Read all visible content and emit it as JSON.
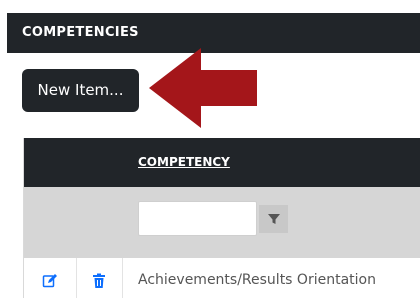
{
  "section": {
    "title": "COMPETENCIES"
  },
  "toolbar": {
    "new_item_label": "New Item..."
  },
  "table": {
    "columns": [
      {
        "label": "COMPETENCY"
      }
    ],
    "filter": {
      "value": "",
      "icon": "filter-icon"
    },
    "rows": [
      {
        "competency": "Achievements/Results Orientation"
      }
    ]
  },
  "colors": {
    "header_bg": "#212529",
    "filter_row_bg": "#d6d6d6",
    "arrow": "#a4161a",
    "icon_accent": "#0d6efd"
  }
}
